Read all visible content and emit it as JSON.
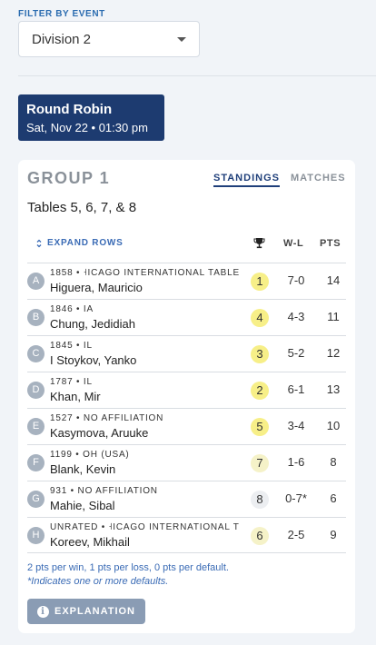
{
  "filter": {
    "label": "FILTER BY EVENT",
    "selected": "Division 2"
  },
  "round": {
    "title": "Round Robin",
    "date": "Sat, Nov 22 • 01:30 pm"
  },
  "group": {
    "title": "GROUP 1",
    "tabs": [
      {
        "label": "STANDINGS",
        "active": true
      },
      {
        "label": "MATCHES",
        "active": false
      }
    ],
    "tables": "Tables 5, 6, 7, & 8",
    "expand_label": "EXPAND ROWS",
    "columns": {
      "place_icon": "trophy-icon",
      "wl": "W-L",
      "pts": "PTS"
    },
    "players": [
      {
        "seed": "A",
        "meta": "1858 • ˧ICAGO INTERNATIONAL TABLE",
        "name": "Higuera, Mauricio",
        "place": "1",
        "wl": "7-0",
        "pts": "14",
        "place_style": "gold"
      },
      {
        "seed": "B",
        "meta": "1846 • IA",
        "name": "Chung, Jedidiah",
        "place": "4",
        "wl": "4-3",
        "pts": "11",
        "place_style": "gold"
      },
      {
        "seed": "C",
        "meta": "1845 • IL",
        "name": "I Stoykov, Yanko",
        "place": "3",
        "wl": "5-2",
        "pts": "12",
        "place_style": "gold"
      },
      {
        "seed": "D",
        "meta": "1787 • IL",
        "name": "Khan, Mir",
        "place": "2",
        "wl": "6-1",
        "pts": "13",
        "place_style": "gold"
      },
      {
        "seed": "E",
        "meta": "1527 • NO AFFILIATION",
        "name": "Kasymova, Aruuke",
        "place": "5",
        "wl": "3-4",
        "pts": "10",
        "place_style": "gold"
      },
      {
        "seed": "F",
        "meta": "1199 • OH (USA)",
        "name": "Blank, Kevin",
        "place": "7",
        "wl": "1-6",
        "pts": "8",
        "place_style": "soft"
      },
      {
        "seed": "G",
        "meta": "931 • NO AFFILIATION",
        "name": "Mahie, Sibal",
        "place": "8",
        "wl": "0-7*",
        "pts": "6",
        "place_style": "grey"
      },
      {
        "seed": "H",
        "meta": "UNRATED • ˧ICAGO INTERNATIONAL T",
        "name": "Koreev, Mikhail",
        "place": "6",
        "wl": "2-5",
        "pts": "9",
        "place_style": "soft"
      }
    ],
    "note_points": "2 pts per win, 1 pts per loss, 0 pts per default.",
    "note_defaults": "*Indicates one or more defaults.",
    "explanation_button": "EXPLANATION"
  },
  "colors": {
    "navy": "#1d3b70",
    "link_blue": "#3a6bb5",
    "gold": "#f7ef88"
  }
}
